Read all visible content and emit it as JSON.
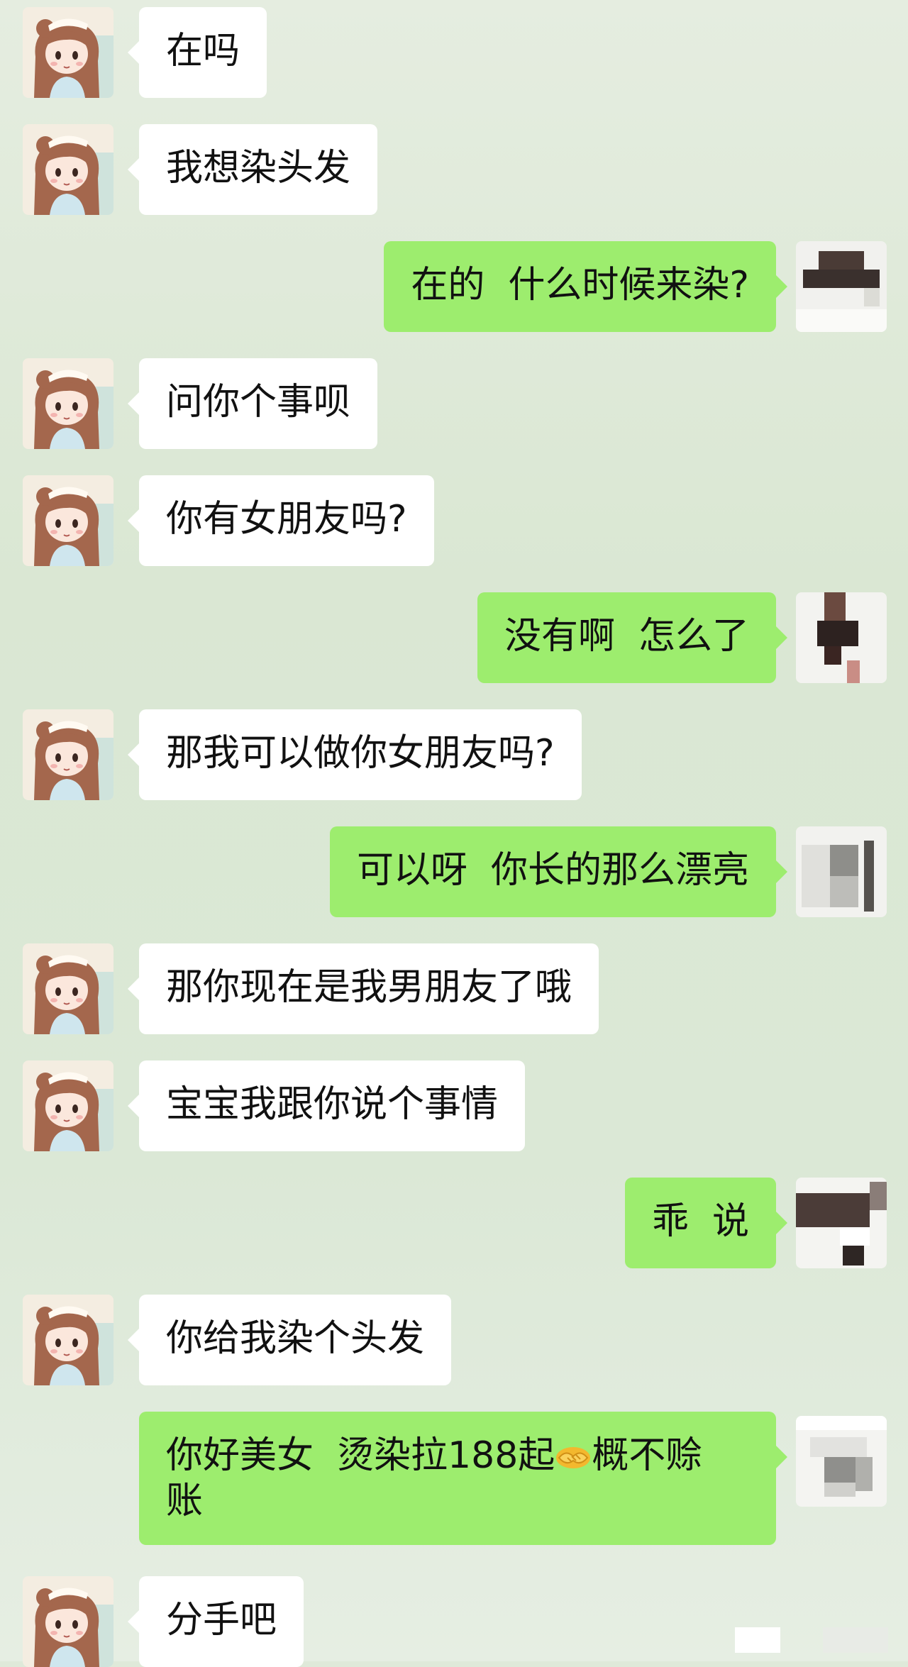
{
  "messages": [
    {
      "from": "other",
      "text": "在吗"
    },
    {
      "from": "other",
      "text": "我想染头发"
    },
    {
      "from": "me",
      "text": "在的  什么时候来染?"
    },
    {
      "from": "other",
      "text": "问你个事呗"
    },
    {
      "from": "other",
      "text": "你有女朋友吗?"
    },
    {
      "from": "me",
      "text": "没有啊  怎么了"
    },
    {
      "from": "other",
      "text": "那我可以做你女朋友吗?"
    },
    {
      "from": "me",
      "text": "可以呀  你长的那么漂亮"
    },
    {
      "from": "other",
      "text": "那你现在是我男朋友了哦"
    },
    {
      "from": "other",
      "text": "宝宝我跟你说个事情"
    },
    {
      "from": "me",
      "text": "乖  说"
    },
    {
      "from": "other",
      "text": "你给我染个头发"
    },
    {
      "from": "me",
      "text_a": "你好美女  烫染拉188起",
      "emoji": "handshake-emoji",
      "text_b": "概不赊\n账"
    },
    {
      "from": "other",
      "text": "分手吧"
    }
  ],
  "avatars": {
    "other": "cartoon-girl-avatar",
    "me": "pixelated-avatar"
  },
  "colors": {
    "background": "#dde9d7",
    "incoming_bubble": "#ffffff",
    "outgoing_bubble": "#9ded6e",
    "text": "#111111"
  }
}
